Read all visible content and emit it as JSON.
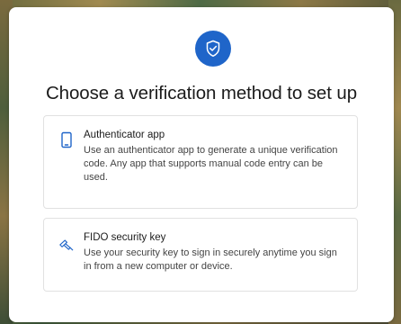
{
  "header": {
    "badge_icon": "shield-check-icon",
    "title": "Choose a verification method to set up"
  },
  "methods": [
    {
      "icon": "phone-icon",
      "title": "Authenticator app",
      "description": "Use an authenticator app to generate a unique verification code. Any app that supports manual code entry can be used."
    },
    {
      "icon": "security-key-icon",
      "title": "FIDO security key",
      "description": "Use your security key to sign in securely anytime you sign in from a new computer or device."
    }
  ],
  "colors": {
    "accent": "#1f65c9",
    "title_text": "#1b1b1b",
    "body_text": "#444444",
    "card_border": "#e1e1e1"
  }
}
